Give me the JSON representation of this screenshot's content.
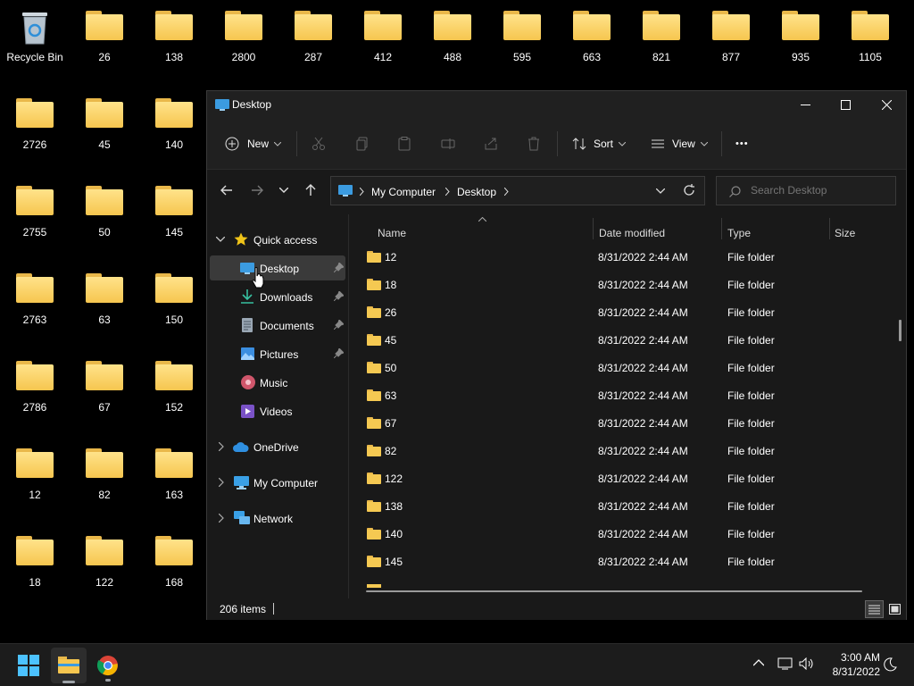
{
  "desktop": {
    "recycle_bin_label": "Recycle Bin",
    "row1": [
      "26",
      "138",
      "2800",
      "287",
      "412",
      "488",
      "595",
      "663",
      "821",
      "877",
      "935",
      "1105"
    ],
    "col1": [
      "2726",
      "2755",
      "2763",
      "2786",
      "12",
      "18"
    ],
    "col2": [
      "45",
      "50",
      "63",
      "67",
      "82",
      "122"
    ],
    "col3": [
      "140",
      "145",
      "150",
      "152",
      "163",
      "168"
    ]
  },
  "window": {
    "title": "Desktop",
    "toolbar": {
      "new_label": "New",
      "sort_label": "Sort",
      "view_label": "View",
      "more_label": "•••"
    },
    "address": {
      "crumbs": [
        "My Computer",
        "Desktop"
      ]
    },
    "search": {
      "placeholder": "Search Desktop"
    },
    "sidebar": {
      "quick_access": "Quick access",
      "pinned": [
        "Desktop",
        "Downloads",
        "Documents",
        "Pictures"
      ],
      "unpinned": [
        "Music",
        "Videos"
      ],
      "onedrive": "OneDrive",
      "my_computer": "My Computer",
      "network": "Network"
    },
    "columns": {
      "name": "Name",
      "date": "Date modified",
      "type": "Type",
      "size": "Size"
    },
    "rows": [
      {
        "name": "12",
        "date": "8/31/2022 2:44 AM",
        "type": "File folder"
      },
      {
        "name": "18",
        "date": "8/31/2022 2:44 AM",
        "type": "File folder"
      },
      {
        "name": "26",
        "date": "8/31/2022 2:44 AM",
        "type": "File folder"
      },
      {
        "name": "45",
        "date": "8/31/2022 2:44 AM",
        "type": "File folder"
      },
      {
        "name": "50",
        "date": "8/31/2022 2:44 AM",
        "type": "File folder"
      },
      {
        "name": "63",
        "date": "8/31/2022 2:44 AM",
        "type": "File folder"
      },
      {
        "name": "67",
        "date": "8/31/2022 2:44 AM",
        "type": "File folder"
      },
      {
        "name": "82",
        "date": "8/31/2022 2:44 AM",
        "type": "File folder"
      },
      {
        "name": "122",
        "date": "8/31/2022 2:44 AM",
        "type": "File folder"
      },
      {
        "name": "138",
        "date": "8/31/2022 2:44 AM",
        "type": "File folder"
      },
      {
        "name": "140",
        "date": "8/31/2022 2:44 AM",
        "type": "File folder"
      },
      {
        "name": "145",
        "date": "8/31/2022 2:44 AM",
        "type": "File folder"
      }
    ],
    "status": {
      "items_count": "206 items"
    }
  },
  "taskbar": {
    "time": "3:00 AM",
    "date": "8/31/2022"
  },
  "colors": {
    "folder": "#f6c64f",
    "accent": "#4aa3df",
    "selected": "#3a3a3a"
  }
}
